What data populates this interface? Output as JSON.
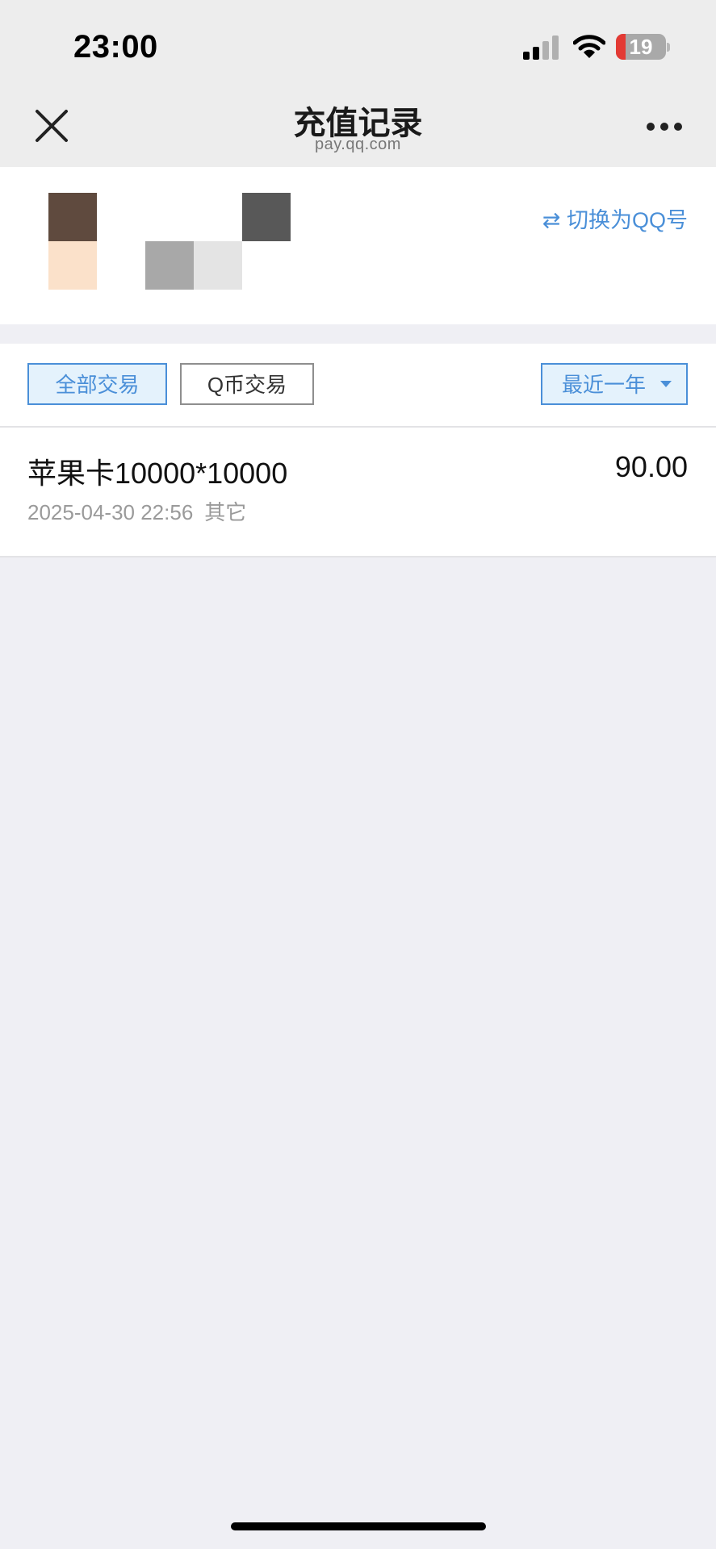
{
  "status_bar": {
    "time": "23:00",
    "battery_level": "19",
    "icons": [
      "cellular-signal-icon",
      "wifi-icon",
      "battery-icon"
    ]
  },
  "nav": {
    "title": "充值记录",
    "subtitle": "pay.qq.com",
    "icons": [
      "close-icon",
      "more-icon"
    ]
  },
  "account": {
    "switch_label": "⇄ 切换为QQ号",
    "avatar_colors": [
      "#5f4a3e",
      "#fbe1ca",
      "#a8a8a8",
      "#e4e4e4",
      "#585858"
    ]
  },
  "filters": {
    "all_label": "全部交易",
    "qcoin_label": "Q币交易",
    "range_label": "最近一年",
    "selected": "全部交易"
  },
  "records": [
    {
      "title": "苹果卡10000*10000",
      "amount": "90.00",
      "datetime": "2025-04-30 22:56",
      "category": "其它"
    }
  ],
  "colors": {
    "accent": "#4a8fd8",
    "accent_bg": "#e4f2fc",
    "page_bg": "#efeff4",
    "nav_bg": "#ededed"
  }
}
